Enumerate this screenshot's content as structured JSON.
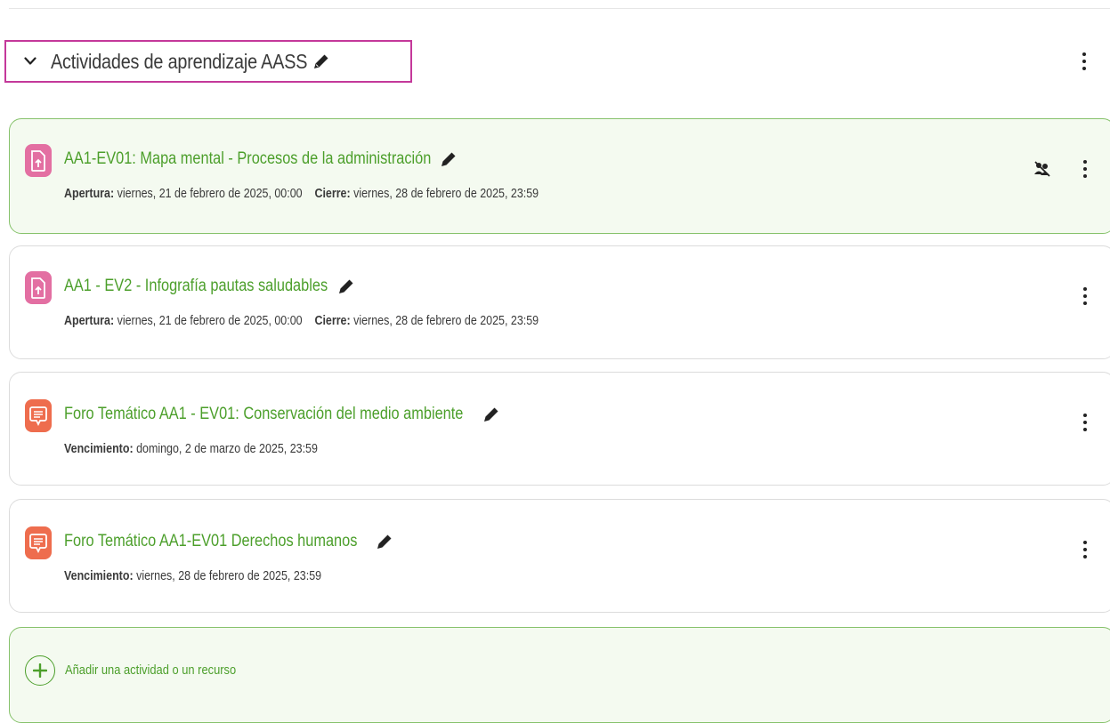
{
  "section": {
    "title": "Actividades de aprendizaje AASS",
    "accent_color": "#c4389a"
  },
  "colors": {
    "link_green": "#4c9f2b",
    "highlight_bg": "#f4faf0",
    "assign_icon_bg": "#e36fa2",
    "forum_icon_bg": "#ee6d4e"
  },
  "activities": [
    {
      "type": "assign",
      "icon": "assignment-icon",
      "title": "AA1-EV01: Mapa mental - Procesos de la administración",
      "date_label_1": "Apertura:",
      "date_value_1": "viernes, 21 de febrero de 2025, 00:00",
      "date_label_2": "Cierre:",
      "date_value_2": "viernes, 28 de febrero de 2025, 23:59",
      "has_restriction_icon": true,
      "highlighted": true
    },
    {
      "type": "assign",
      "icon": "assignment-icon",
      "title": "AA1 - EV2 - Infografía pautas saludables",
      "date_label_1": "Apertura:",
      "date_value_1": "viernes, 21 de febrero de 2025, 00:00",
      "date_label_2": "Cierre:",
      "date_value_2": "viernes, 28 de febrero de 2025, 23:59",
      "has_restriction_icon": false,
      "highlighted": false
    },
    {
      "type": "forum",
      "icon": "forum-icon",
      "title": "Foro Temático AA1 - EV01: Conservación del medio ambiente",
      "date_label_1": "Vencimiento:",
      "date_value_1": "domingo, 2 de marzo de 2025, 23:59",
      "has_restriction_icon": false,
      "highlighted": false
    },
    {
      "type": "forum",
      "icon": "forum-icon",
      "title": "Foro Temático AA1-EV01 Derechos humanos",
      "date_label_1": "Vencimiento:",
      "date_value_1": "viernes, 28 de febrero de 2025, 23:59",
      "has_restriction_icon": false,
      "highlighted": false
    }
  ],
  "add_activity": {
    "label": "Añadir una actividad o un recurso",
    "icon": "plus-circle-icon"
  }
}
